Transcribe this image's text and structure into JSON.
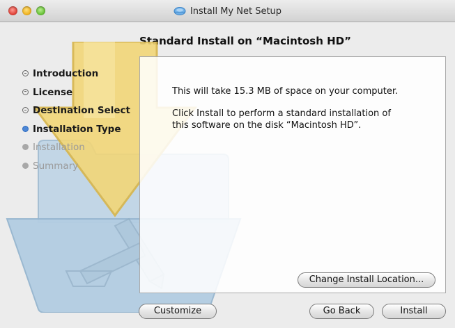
{
  "window": {
    "title": "Install My Net Setup",
    "traffic_lights": [
      "close",
      "minimize",
      "zoom"
    ]
  },
  "page": {
    "heading": "Standard Install on “Macintosh HD”"
  },
  "steps": [
    {
      "label": "Introduction",
      "state": "done"
    },
    {
      "label": "License",
      "state": "done"
    },
    {
      "label": "Destination Select",
      "state": "done"
    },
    {
      "label": "Installation Type",
      "state": "current"
    },
    {
      "label": "Installation",
      "state": "future"
    },
    {
      "label": "Summary",
      "state": "future"
    }
  ],
  "content": {
    "space_message": "This will take 15.3 MB of space on your computer.",
    "install_message": "Click Install to perform a standard installation of this software on the disk “Macintosh HD”."
  },
  "buttons": {
    "change_location": "Change Install Location...",
    "customize": "Customize",
    "go_back": "Go Back",
    "install": "Install"
  },
  "colors": {
    "current_step": "#4d87d6",
    "content_bg": "#ffffff",
    "window_bg": "#ececec"
  },
  "icons": {
    "title_icon": "network-globe-icon",
    "background": "installer-folder-arrow-art"
  }
}
